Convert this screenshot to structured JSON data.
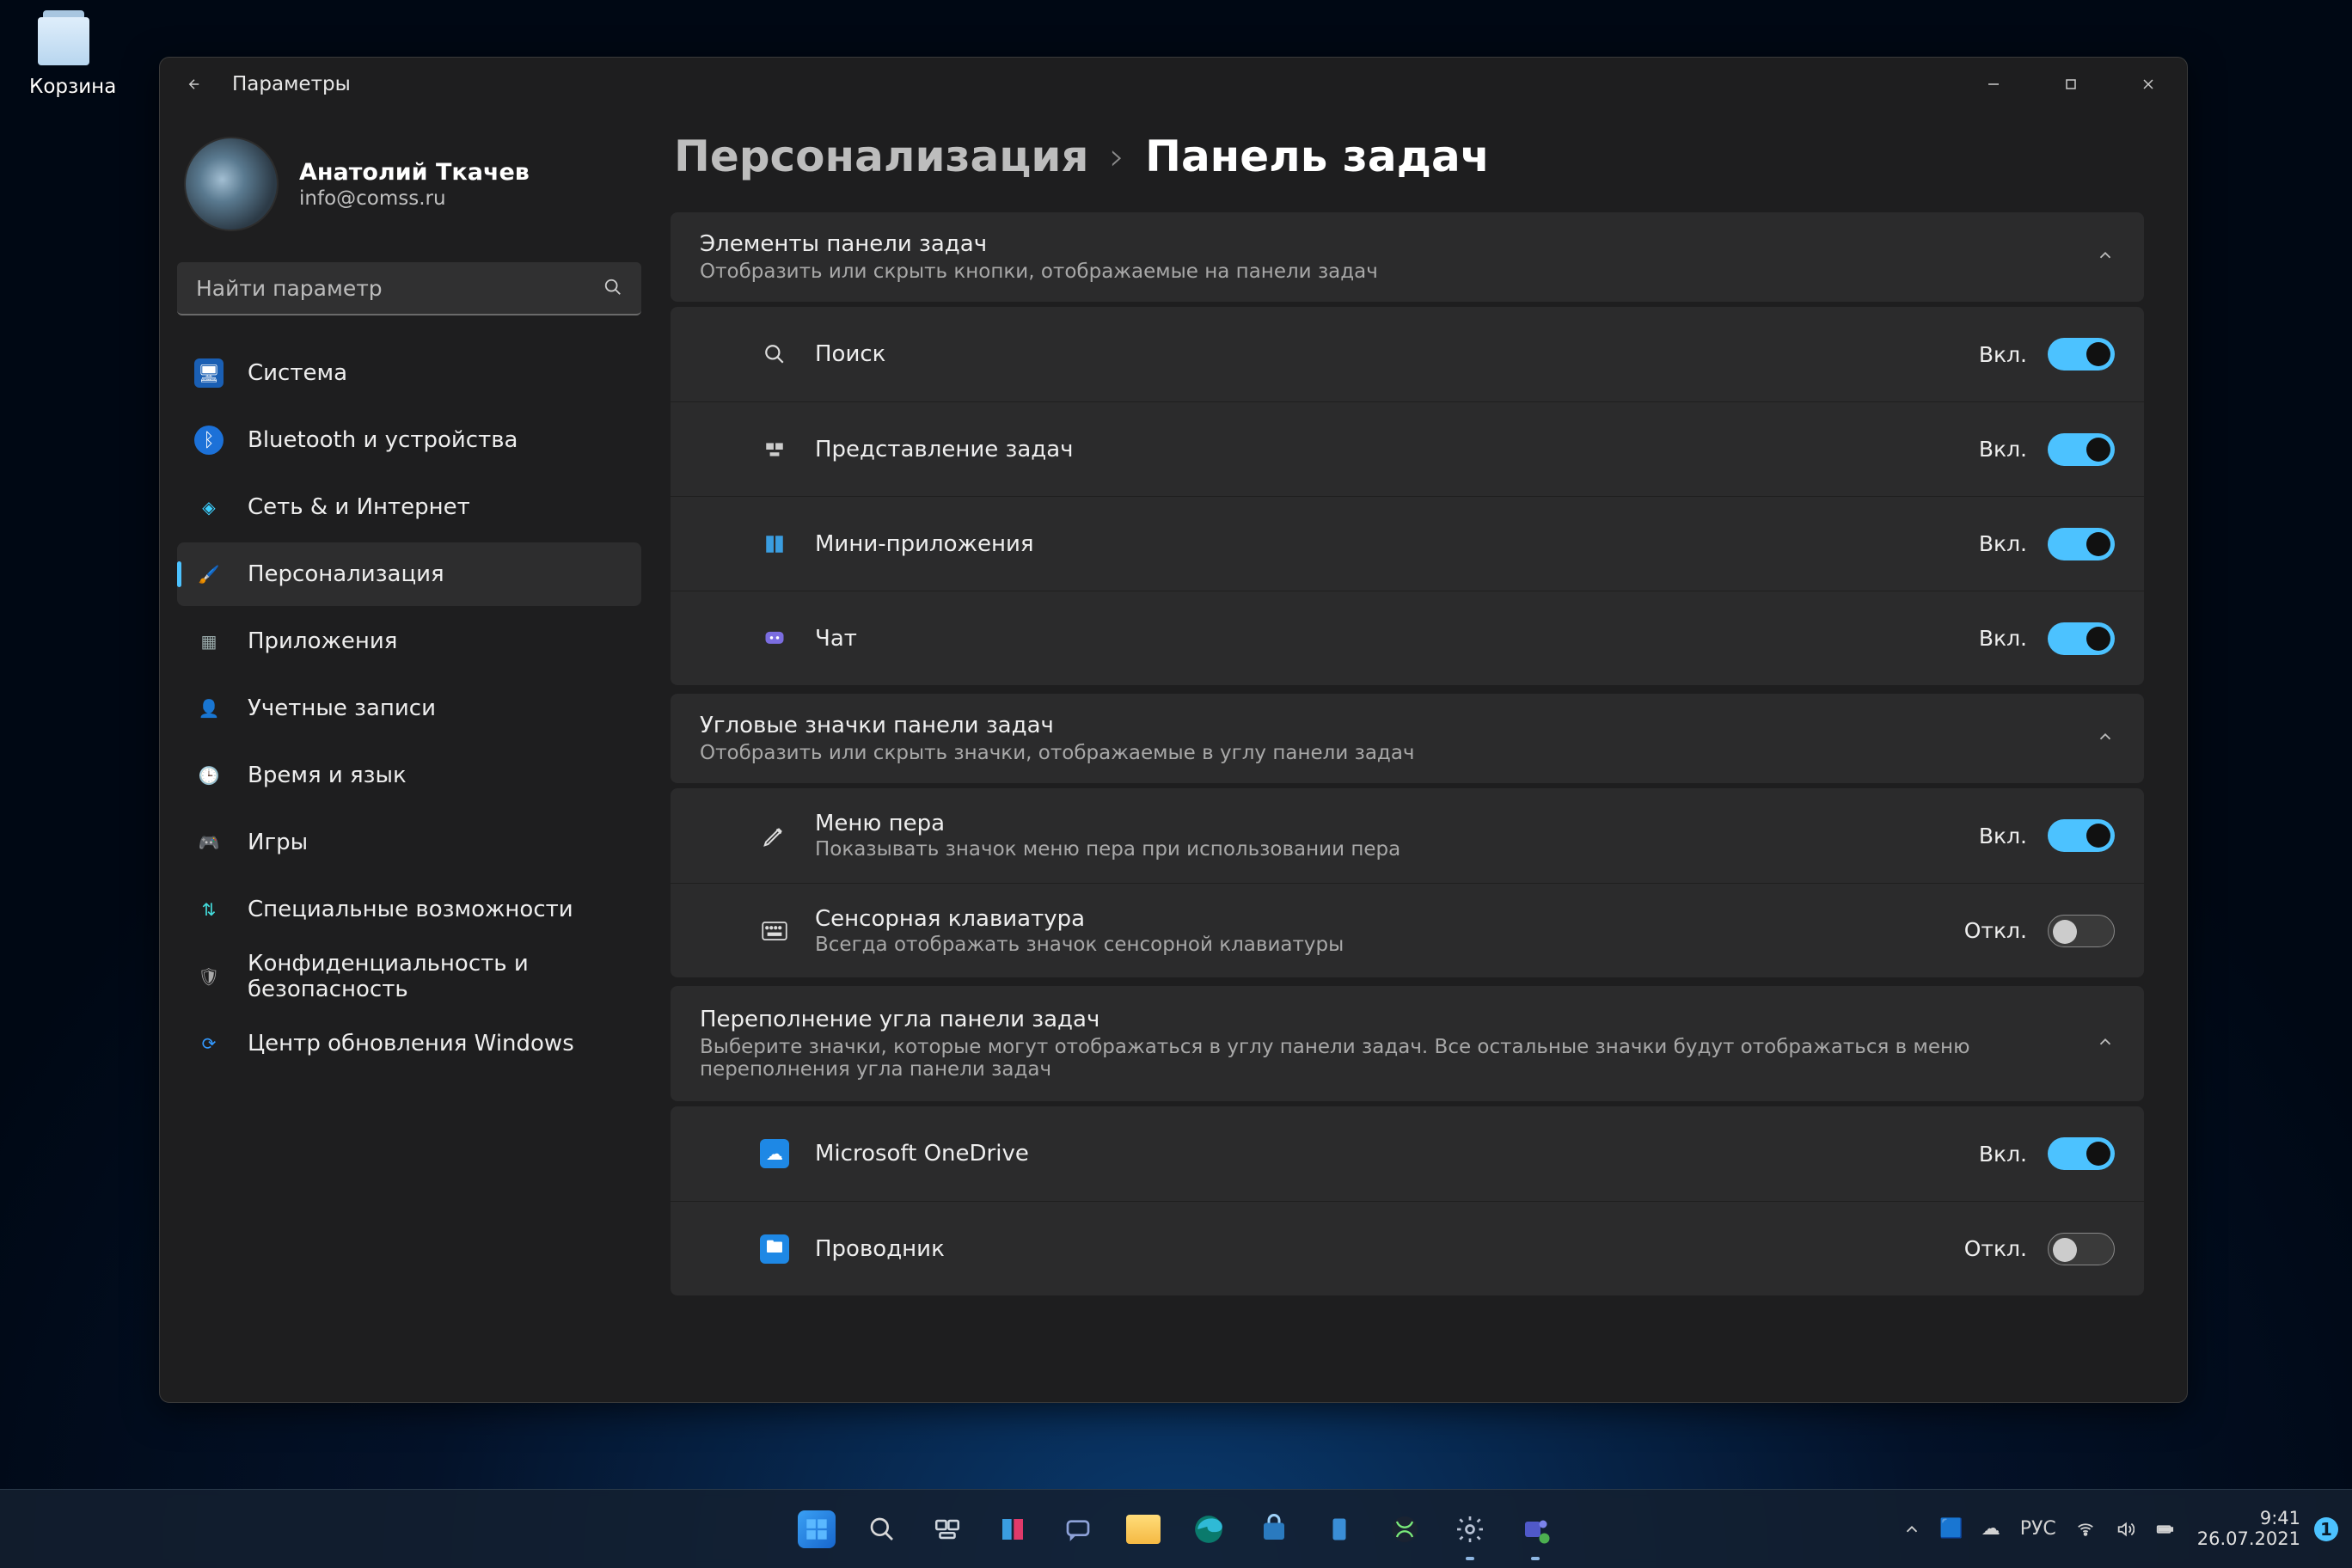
{
  "desktop": {
    "recycle_bin": "Корзина"
  },
  "window": {
    "title": "Параметры",
    "profile": {
      "name": "Анатолий Ткачев",
      "email": "info@comss.ru"
    },
    "search": {
      "placeholder": "Найти параметр"
    },
    "nav": [
      {
        "id": "system",
        "label": "Система",
        "icon": "🖥️"
      },
      {
        "id": "bluetooth",
        "label": "Bluetooth и устройства",
        "icon": "B"
      },
      {
        "id": "network",
        "label": "Сеть & и Интернет",
        "icon": "📶"
      },
      {
        "id": "personalization",
        "label": "Персонализация",
        "icon": "🖌️",
        "active": true
      },
      {
        "id": "apps",
        "label": "Приложения",
        "icon": "▦"
      },
      {
        "id": "accounts",
        "label": "Учетные записи",
        "icon": "👤"
      },
      {
        "id": "time",
        "label": "Время и язык",
        "icon": "🌐"
      },
      {
        "id": "gaming",
        "label": "Игры",
        "icon": "🎮"
      },
      {
        "id": "accessibility",
        "label": "Специальные возможности",
        "icon": "♿"
      },
      {
        "id": "privacy",
        "label": "Конфиденциальность и безопасность",
        "icon": "🛡️"
      },
      {
        "id": "update",
        "label": "Центр обновления Windows",
        "icon": "🔄"
      }
    ],
    "crumbs": {
      "parent": "Персонализация",
      "current": "Панель задач"
    },
    "sections": {
      "items": {
        "title": "Элементы панели задач",
        "sub": "Отобразить или скрыть кнопки, отображаемые на панели задач",
        "rows": [
          {
            "id": "search",
            "title": "Поиск",
            "state": "Вкл.",
            "on": true
          },
          {
            "id": "taskview",
            "title": "Представление задач",
            "state": "Вкл.",
            "on": true
          },
          {
            "id": "widgets",
            "title": "Мини-приложения",
            "state": "Вкл.",
            "on": true
          },
          {
            "id": "chat",
            "title": "Чат",
            "state": "Вкл.",
            "on": true
          }
        ]
      },
      "corner": {
        "title": "Угловые значки панели задач",
        "sub": "Отобразить или скрыть значки, отображаемые в углу панели задач",
        "rows": [
          {
            "id": "pen",
            "title": "Меню пера",
            "sub": "Показывать значок меню пера при использовании пера",
            "state": "Вкл.",
            "on": true
          },
          {
            "id": "touchkb",
            "title": "Сенсорная клавиатура",
            "sub": "Всегда отображать значок сенсорной клавиатуры",
            "state": "Откл.",
            "on": false
          }
        ]
      },
      "overflow": {
        "title": "Переполнение угла панели задач",
        "sub": "Выберите значки, которые могут отображаться в углу панели задач. Все остальные значки будут отображаться в меню переполнения угла панели задач",
        "rows": [
          {
            "id": "onedrive",
            "title": "Microsoft OneDrive",
            "state": "Вкл.",
            "on": true
          },
          {
            "id": "explorer",
            "title": "Проводник",
            "state": "Откл.",
            "on": false
          }
        ]
      }
    }
  },
  "taskbar": {
    "lang": "РУС",
    "time": "9:41",
    "date": "26.07.2021",
    "notif": "1"
  }
}
